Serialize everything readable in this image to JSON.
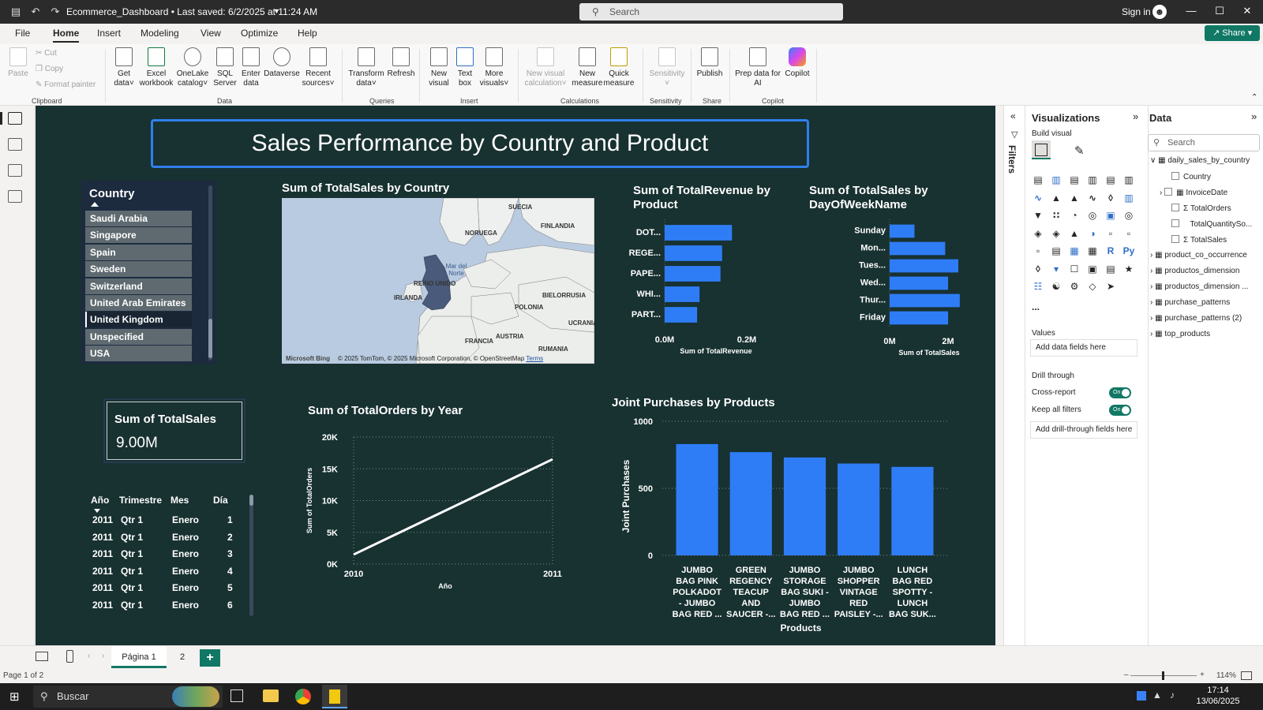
{
  "titlebar": {
    "title": "Ecommerce_Dashboard • Last saved: 6/2/2025 at 11:24 AM",
    "search_placeholder": "Search",
    "sign_in": "Sign in",
    "share": "Share"
  },
  "menu": {
    "tabs": [
      "File",
      "Home",
      "Insert",
      "Modeling",
      "View",
      "Optimize",
      "Help"
    ],
    "active": "Home"
  },
  "ribbon": {
    "clipboard": {
      "paste": "Paste",
      "cut": "Cut",
      "copy": "Copy",
      "format_painter": "Format painter",
      "group": "Clipboard"
    },
    "data": {
      "get_data": [
        "Get",
        "data"
      ],
      "excel": [
        "Excel",
        "workbook"
      ],
      "onelake": [
        "OneLake",
        "catalog"
      ],
      "sql": [
        "SQL",
        "Server"
      ],
      "enter": [
        "Enter",
        "data"
      ],
      "dataverse": [
        "Dataverse",
        ""
      ],
      "recent": [
        "Recent",
        "sources"
      ],
      "group": "Data"
    },
    "queries": {
      "transform": [
        "Transform",
        "data"
      ],
      "refresh": [
        "Refresh",
        ""
      ],
      "group": "Queries"
    },
    "insert": {
      "new_visual": [
        "New",
        "visual"
      ],
      "text_box": [
        "Text",
        "box"
      ],
      "more_visuals": [
        "More",
        "visuals"
      ],
      "group": "Insert"
    },
    "calculations": {
      "new_visual_calc": [
        "New visual",
        "calculation"
      ],
      "new_measure": [
        "New",
        "measure"
      ],
      "quick_measure": [
        "Quick",
        "measure"
      ],
      "group": "Calculations"
    },
    "sensitivity": {
      "label": [
        "Sensitivity",
        ""
      ],
      "group": "Sensitivity"
    },
    "share": {
      "publish": [
        "Publish",
        ""
      ],
      "group": "Share"
    },
    "copilot": {
      "prep": [
        "Prep data for",
        "AI"
      ],
      "copilot": [
        "Copilot",
        ""
      ],
      "group": "Copilot"
    }
  },
  "report": {
    "title": "Sales Performance by Country and Product",
    "slicer": {
      "header": "Country",
      "items": [
        "Saudi Arabia",
        "Singapore",
        "Spain",
        "Sweden",
        "Switzerland",
        "United Arab Emirates",
        "United Kingdom",
        "Unspecified",
        "USA"
      ],
      "selected": "United Kingdom"
    },
    "map": {
      "title": "Sum of TotalSales by Country",
      "labels": [
        "SUECIA",
        "NORUEGA",
        "FINLANDIA",
        "Mar del Norte",
        "REINO UNIDO",
        "IRLANDA",
        "BIELORRUSIA",
        "POLONIA",
        "UCRANIA",
        "FRANCIA",
        "AUSTRIA",
        "RUMANIA"
      ],
      "attribution": "© 2025 TomTom, © 2025 Microsoft Corporation, © OpenStreetMap",
      "terms": "Terms",
      "bing": "Microsoft Bing"
    },
    "kpi": {
      "label": "Sum of TotalSales",
      "value": "9.00M"
    },
    "table": {
      "headers": [
        "Año",
        "Trimestre",
        "Mes",
        "Día"
      ],
      "rows": [
        [
          "2011",
          "Qtr 1",
          "Enero",
          "1"
        ],
        [
          "2011",
          "Qtr 1",
          "Enero",
          "2"
        ],
        [
          "2011",
          "Qtr 1",
          "Enero",
          "3"
        ],
        [
          "2011",
          "Qtr 1",
          "Enero",
          "4"
        ],
        [
          "2011",
          "Qtr 1",
          "Enero",
          "5"
        ],
        [
          "2011",
          "Qtr 1",
          "Enero",
          "6"
        ]
      ]
    }
  },
  "chart_data": [
    {
      "id": "revenue_by_product",
      "type": "bar",
      "orientation": "horizontal",
      "title": "Sum of TotalRevenue by Product",
      "categories": [
        "DOT...",
        "REGE...",
        "PAPE...",
        "WHI...",
        "PART..."
      ],
      "values": [
        0.164,
        0.14,
        0.136,
        0.085,
        0.079
      ],
      "xlabel": "Sum of TotalRevenue",
      "xticks": [
        "0.0M",
        "0.2M"
      ],
      "xlim": [
        0,
        0.25
      ],
      "color": "#2f7df6"
    },
    {
      "id": "sales_by_day",
      "type": "bar",
      "orientation": "horizontal",
      "title": "Sum of TotalSales by DayOfWeekName",
      "categories": [
        "Sunday",
        "Mon...",
        "Tues...",
        "Wed...",
        "Thur...",
        "Friday"
      ],
      "values": [
        0.85,
        1.9,
        2.35,
        2.0,
        2.4,
        2.0
      ],
      "xlabel": "Sum of TotalSales",
      "xticks": [
        "0M",
        "2M"
      ],
      "xlim": [
        0,
        2.7
      ],
      "color": "#2f7df6"
    },
    {
      "id": "orders_by_year",
      "type": "line",
      "title": "Sum of TotalOrders by Year",
      "x": [
        "2010",
        "2011"
      ],
      "values": [
        1500,
        16500
      ],
      "xlabel": "Año",
      "ylabel": "Sum of TotalOrders",
      "yticks": [
        "0K",
        "5K",
        "10K",
        "15K",
        "20K"
      ],
      "ylim": [
        0,
        20000
      ],
      "grid": true,
      "color": "#ffffff"
    },
    {
      "id": "joint_purchases",
      "type": "bar",
      "title": "Joint Purchases by Products",
      "categories": [
        [
          "JUMBO",
          "BAG PINK",
          "POLKADOT",
          "- JUMBO",
          "BAG RED ..."
        ],
        [
          "GREEN",
          "REGENCY",
          "TEACUP",
          "AND",
          "SAUCER -..."
        ],
        [
          "JUMBO",
          "STORAGE",
          "BAG SUKI -",
          "JUMBO",
          "BAG RED ..."
        ],
        [
          "JUMBO",
          "SHOPPER",
          "VINTAGE",
          "RED",
          "PAISLEY -..."
        ],
        [
          "LUNCH",
          "BAG RED",
          "SPOTTY -",
          "LUNCH",
          "BAG SUK..."
        ]
      ],
      "values": [
        830,
        770,
        730,
        685,
        660
      ],
      "xlabel": "Products",
      "ylabel": "Joint Purchases",
      "yticks": [
        "0",
        "500",
        "1000"
      ],
      "ylim": [
        0,
        1000
      ],
      "grid": true,
      "color": "#2f7df6"
    }
  ],
  "filters_label": "Filters",
  "visualizations": {
    "title": "Visualizations",
    "build_visual": "Build visual",
    "values": "Values",
    "add_data": "Add data fields here",
    "drill_through": "Drill through",
    "cross_report": "Cross-report",
    "keep_all_filters": "Keep all filters",
    "toggle_on": "On",
    "add_drill": "Add drill-through fields here",
    "more": "..."
  },
  "data_pane": {
    "title": "Data",
    "search_placeholder": "Search",
    "tables": [
      {
        "name": "daily_sales_by_country",
        "expanded": true,
        "fields": [
          "Country",
          "InvoiceDate",
          "TotalOrders",
          "TotalQuantitySo...",
          "TotalSales"
        ]
      },
      {
        "name": "product_co_occurrence"
      },
      {
        "name": "productos_dimension"
      },
      {
        "name": "productos_dimension ..."
      },
      {
        "name": "purchase_patterns"
      },
      {
        "name": "purchase_patterns (2)"
      },
      {
        "name": "top_products"
      }
    ]
  },
  "pages": {
    "tabs": [
      "Página 1",
      "2"
    ],
    "active": "Página 1",
    "add": "+"
  },
  "status": {
    "page": "Page 1 of 2",
    "zoom": "114%"
  },
  "taskbar": {
    "search": "Buscar",
    "time": "17:14",
    "date": "13/06/2025"
  },
  "colors": {
    "canvas": "#183131",
    "bar": "#2f7df6",
    "accent": "#117865",
    "title_border": "#2f80ed"
  }
}
